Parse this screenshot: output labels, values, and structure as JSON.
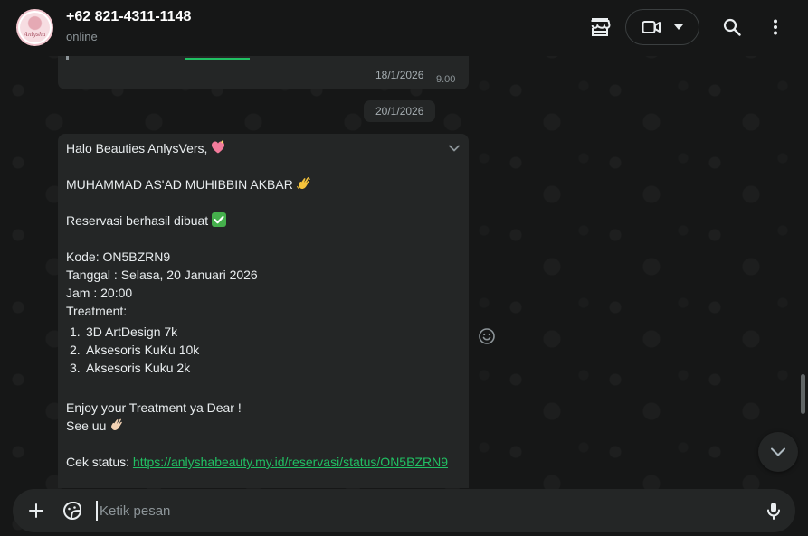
{
  "header": {
    "avatar_text": "Anlysha",
    "contact_name": "+62 821-4311-1148",
    "status": "online",
    "icons": [
      "shop-icon",
      "video-camera-icon",
      "chevron-down-icon",
      "search-icon",
      "more-vert-icon"
    ]
  },
  "chat": {
    "previous_message": {
      "time": "9.00"
    },
    "date_separators": [
      "18/1/2026",
      "20/1/2026"
    ],
    "message": {
      "greeting": "Halo Beauties AnlysVers,",
      "customer_name": "MUHAMMAD AS'AD MUHIBBIN AKBAR",
      "confirmation": "Reservasi berhasil dibuat",
      "code": "Kode: ON5BZRN9",
      "date": "Tanggal : Selasa, 20 Januari 2026",
      "time": "Jam : 20:00",
      "treatment_label": "Treatment:",
      "treatments": [
        {
          "num": "1.",
          "name": "3D ArtDesign 7k"
        },
        {
          "num": "2.",
          "name": "Aksesoris KuKu 10k"
        },
        {
          "num": "3.",
          "name": "Aksesoris Kuku 2k"
        }
      ],
      "closing": "Enjoy your Treatment ya Dear !",
      "see_you": "See uu",
      "status_label": "Cek status: ",
      "status_link": "https://anlyshabeauty.my.id/reservasi/status/ON5BZRN9"
    }
  },
  "composer": {
    "placeholder": "Ketik pesan",
    "value": ""
  },
  "colors": {
    "background": "#161717",
    "bubble": "#242626",
    "link": "#21c063",
    "text": "#e9edef",
    "muted": "#8d9599"
  }
}
